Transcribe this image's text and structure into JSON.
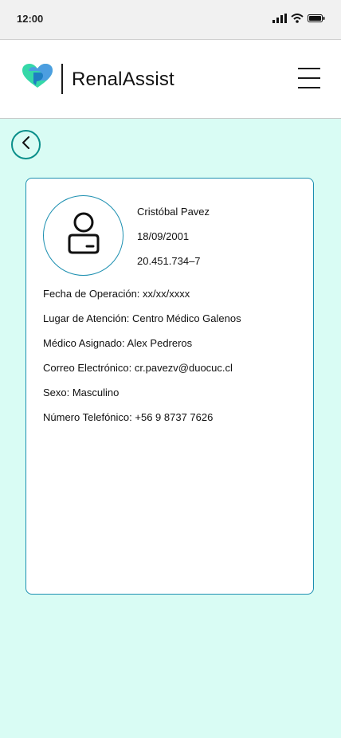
{
  "status_bar": {
    "time": "12:00",
    "icons": [
      "signal-icon",
      "wifi-icon",
      "battery-icon"
    ]
  },
  "header": {
    "logo_icon": "heart-logo-icon",
    "title": "RenalAssist",
    "menu_icon": "hamburger-menu-icon"
  },
  "navigation": {
    "back_icon": "chevron-left-icon"
  },
  "profile": {
    "avatar_icon": "user-icon",
    "name": "Cristóbal Pavez",
    "birth_date": "18/09/2001",
    "id_number": "20.451.734–7",
    "details": [
      {
        "label": "Fecha de Operación: xx/xx/xxxx"
      },
      {
        "label": "Lugar de Atención: Centro Médico Galenos"
      },
      {
        "label": "Médico Asignado: Alex Pedreros"
      },
      {
        "label": "Correo Electrónico: cr.pavezv@duocuc.cl"
      },
      {
        "label": "Sexo: Masculino"
      },
      {
        "label": "Número Telefónico: +56 9 8737 7626"
      }
    ]
  },
  "colors": {
    "background": "#d9fcf4",
    "accent_teal": "#0a8f8a",
    "card_border": "#1c8fb0",
    "logo_green": "#35d8a8",
    "logo_blue": "#1e88c8"
  }
}
